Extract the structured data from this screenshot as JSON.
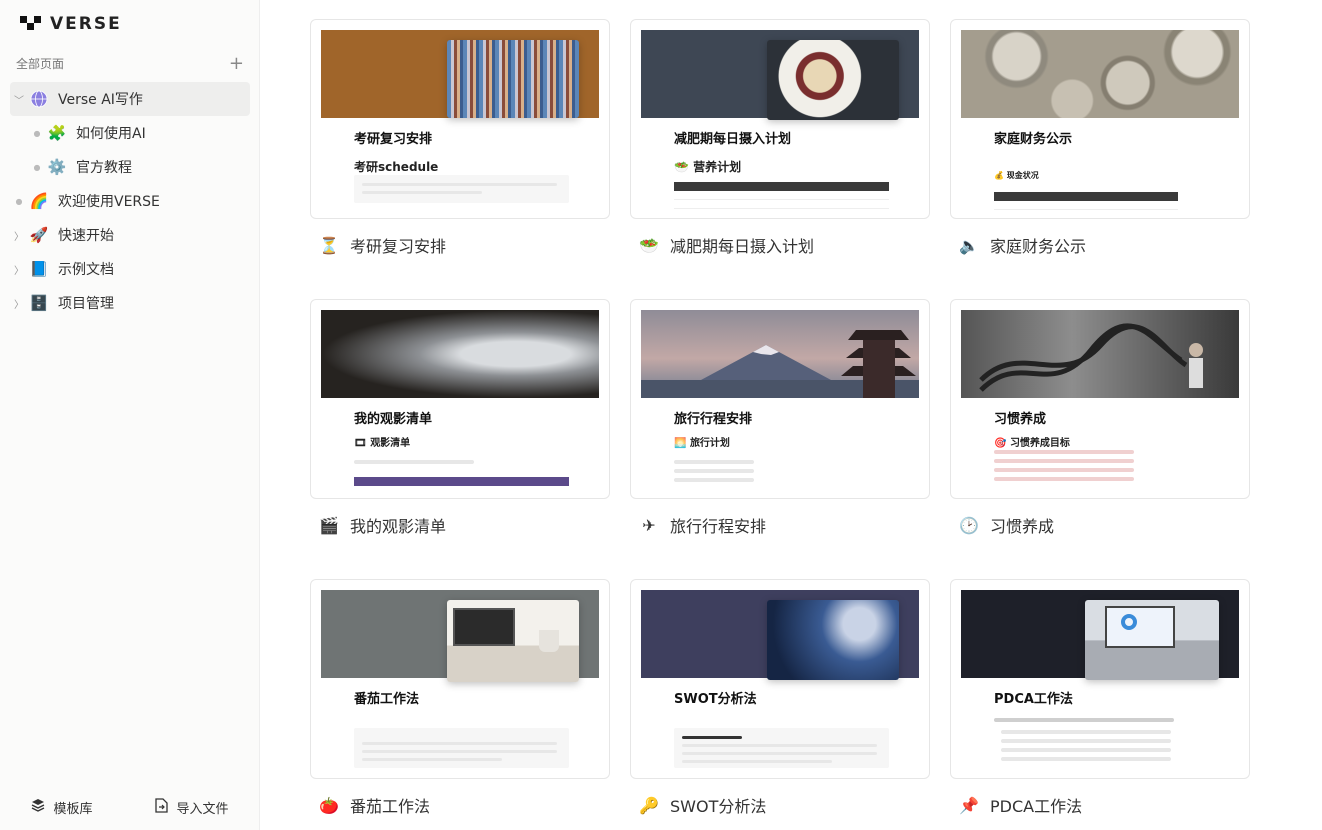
{
  "app": {
    "name": "VERSE"
  },
  "sidebar": {
    "section_title": "全部页面",
    "add_symbol": "+",
    "items": [
      {
        "label": "Verse AI写作",
        "icon": "🌐",
        "active": true
      },
      {
        "label": "如何使用AI",
        "icon": "🧩"
      },
      {
        "label": "官方教程",
        "icon": "⚙️"
      },
      {
        "label": "欢迎使用VERSE",
        "icon": "🌈"
      },
      {
        "label": "快速开始",
        "icon": "🚀"
      },
      {
        "label": "示例文档",
        "icon": "📘"
      },
      {
        "label": "项目管理",
        "icon": "🗄️"
      }
    ],
    "bottom": {
      "templates": "模板库",
      "import": "导入文件"
    }
  },
  "cards": [
    {
      "label": "考研复习安排",
      "icon": "⏳",
      "doc_title": "考研复习安排",
      "doc_sub": "考研schedule"
    },
    {
      "label": "减肥期每日摄入计划",
      "icon": "🥗",
      "doc_title": "减肥期每日摄入计划",
      "doc_sub": "营养计划"
    },
    {
      "label": "家庭财务公示",
      "icon": "🔈",
      "doc_title": "家庭财务公示",
      "doc_sub": "现金状况"
    },
    {
      "label": "我的观影清单",
      "icon": "🎬",
      "doc_title": "我的观影清单",
      "doc_sub": "观影清单"
    },
    {
      "label": "旅行行程安排",
      "icon": "✈",
      "doc_title": "旅行行程安排",
      "doc_sub": "旅行计划"
    },
    {
      "label": "习惯养成",
      "icon": "🕑",
      "doc_title": "习惯养成",
      "doc_sub": "习惯养成目标"
    },
    {
      "label": "番茄工作法",
      "icon": "🍅",
      "doc_title": "番茄工作法",
      "doc_sub": ""
    },
    {
      "label": "SWOT分析法",
      "icon": "🔑",
      "doc_title": "SWOT分析法",
      "doc_sub": ""
    },
    {
      "label": "PDCA工作法",
      "icon": "📌",
      "doc_title": "PDCA工作法",
      "doc_sub": ""
    }
  ],
  "colors": {
    "sidebar_bg": "#fbfbfa",
    "active_bg": "#eeeeed",
    "cover_1": "#a0652a",
    "cover_2": "#3e4754",
    "cover_4": "#262320",
    "cover_5": "#a79a9d",
    "cover_6": "#3c3c3c",
    "cover_7": "#6f7474",
    "cover_8": "#3e3f5e",
    "cover_9": "#1e2029"
  }
}
